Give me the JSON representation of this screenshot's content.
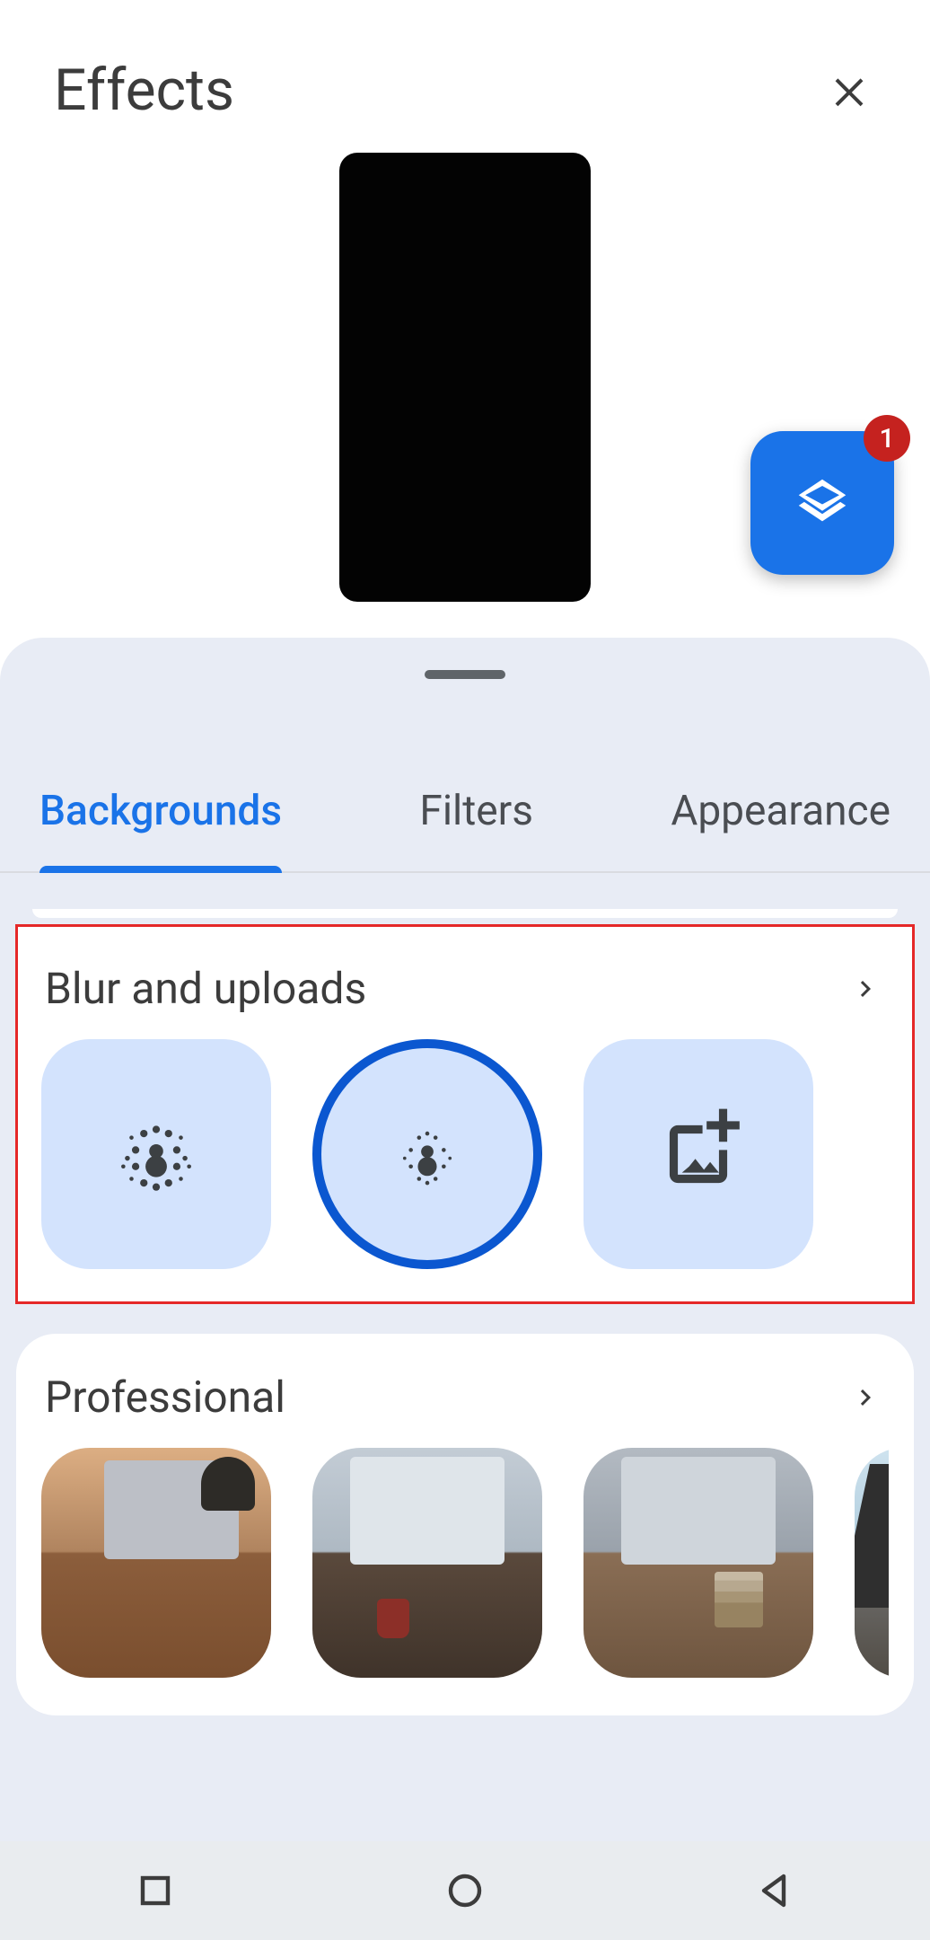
{
  "header": {
    "title": "Effects"
  },
  "fab": {
    "badge": "1"
  },
  "tabs": [
    {
      "label": "Backgrounds",
      "active": true
    },
    {
      "label": "Filters",
      "active": false
    },
    {
      "label": "Appearance",
      "active": false
    }
  ],
  "sections": {
    "blur": {
      "title": "Blur and uploads",
      "options": [
        {
          "id": "blur-strong",
          "selected": false
        },
        {
          "id": "blur-light",
          "selected": true
        },
        {
          "id": "upload-image",
          "selected": false
        }
      ]
    },
    "professional": {
      "title": "Professional",
      "thumbs": [
        "p1",
        "p2",
        "p3",
        "p4"
      ]
    }
  }
}
